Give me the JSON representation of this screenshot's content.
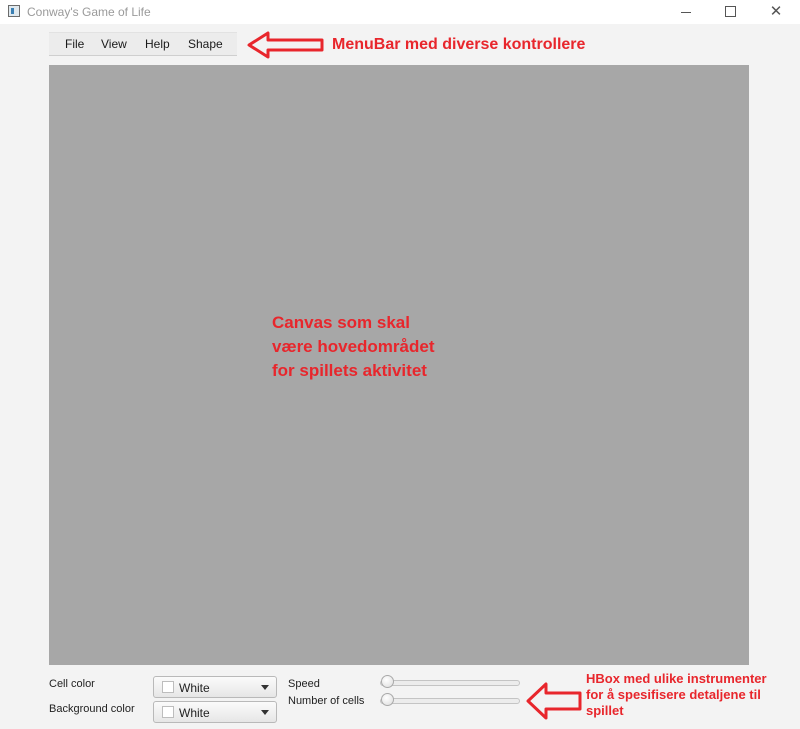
{
  "window": {
    "title": "Conway's Game of Life",
    "controls": {
      "minimize": "",
      "maximize": "",
      "close": "✕"
    }
  },
  "menubar": {
    "items": [
      "File",
      "View",
      "Help",
      "Shape"
    ]
  },
  "annotations": {
    "menubar": "MenuBar med diverse kontrollere",
    "canvas": [
      "Canvas som skal",
      "være hovedområdet",
      "for spillets aktivitet"
    ],
    "hbox": [
      "HBox med ulike instrumenter",
      "for å spesifisere detaljene til",
      "spillet"
    ]
  },
  "controls": {
    "cell_color_label": "Cell color",
    "cell_color_value": "White",
    "background_color_label": "Background color",
    "background_color_value": "White",
    "speed_label": "Speed",
    "number_of_cells_label": "Number of cells"
  },
  "colors": {
    "canvas_bg": "#a7a7a7",
    "annotation": "#e8262c",
    "app_bg": "#f3f3f3"
  }
}
